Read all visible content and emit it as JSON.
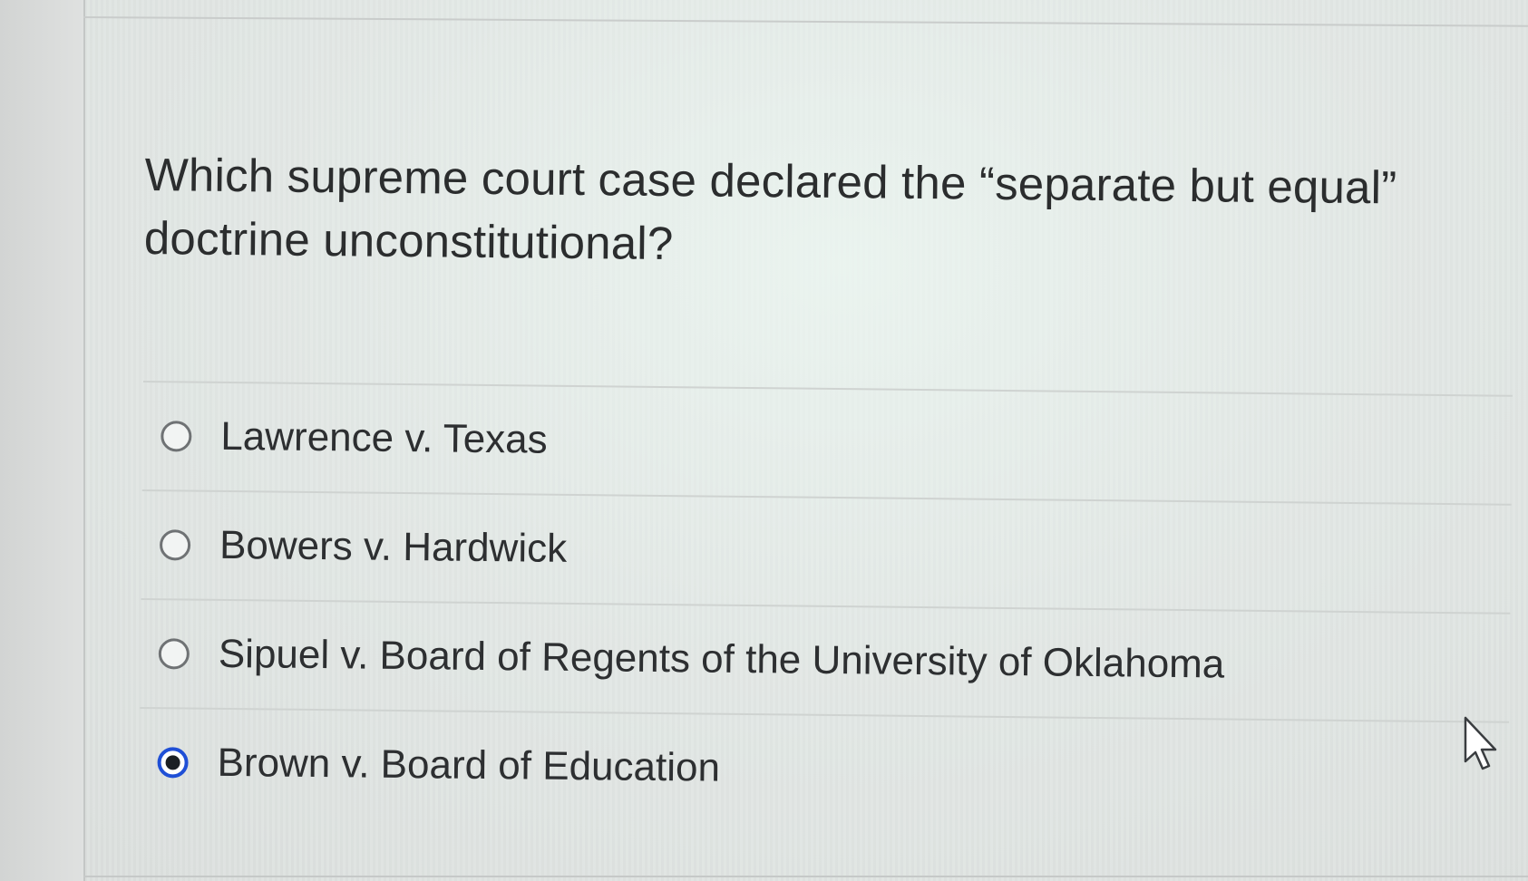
{
  "question": {
    "text": "Which supreme court case declared the “separate but equal” doctrine unconstitutional?"
  },
  "options": [
    {
      "label": "Lawrence v. Texas",
      "selected": false
    },
    {
      "label": "Bowers v. Hardwick",
      "selected": false
    },
    {
      "label": "Sipuel v. Board of Regents of the University of Oklahoma",
      "selected": false
    },
    {
      "label": "Brown v. Board of Education",
      "selected": true
    }
  ],
  "colors": {
    "selected_radio": "#1f4fd6",
    "text": "#2d2f31",
    "background": "#e3e6e4"
  },
  "icons": {
    "cursor": "mouse-pointer-icon"
  }
}
